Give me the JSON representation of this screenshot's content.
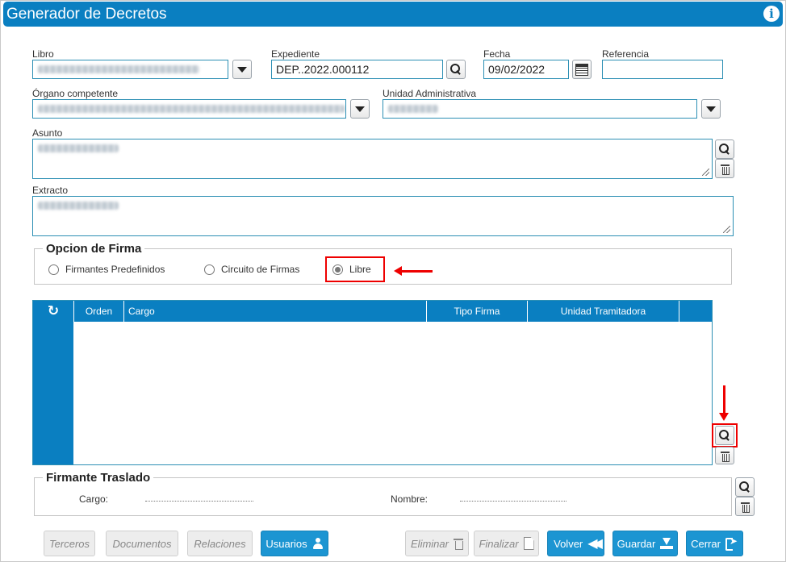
{
  "window": {
    "title": "Generador de Decretos"
  },
  "form": {
    "libro_label": "Libro",
    "expediente_label": "Expediente",
    "expediente_value": "DEP..2022.000112",
    "fecha_label": "Fecha",
    "fecha_value": "09/02/2022",
    "referencia_label": "Referencia",
    "referencia_value": "",
    "organo_label": "Órgano competente",
    "unidad_label": "Unidad Administrativa",
    "asunto_label": "Asunto",
    "extracto_label": "Extracto"
  },
  "firma": {
    "legend": "Opcion de Firma",
    "options": [
      "Firmantes Predefinidos",
      "Circuito de Firmas",
      "Libre"
    ],
    "selected": "Libre"
  },
  "grid": {
    "columns": [
      "Orden",
      "Cargo",
      "Tipo Firma",
      "Unidad Tramitadora"
    ],
    "rows": []
  },
  "traslado": {
    "legend": "Firmante Traslado",
    "cargo_label": "Cargo:",
    "nombre_label": "Nombre:"
  },
  "footer": {
    "terceros": "Terceros",
    "documentos": "Documentos",
    "relaciones": "Relaciones",
    "usuarios": "Usuarios",
    "eliminar": "Eliminar",
    "finalizar": "Finalizar",
    "volver": "Volver",
    "guardar": "Guardar",
    "cerrar": "Cerrar"
  },
  "colors": {
    "accent": "#0a7fc1",
    "button": "#1c95d2",
    "highlight": "#e00000"
  }
}
